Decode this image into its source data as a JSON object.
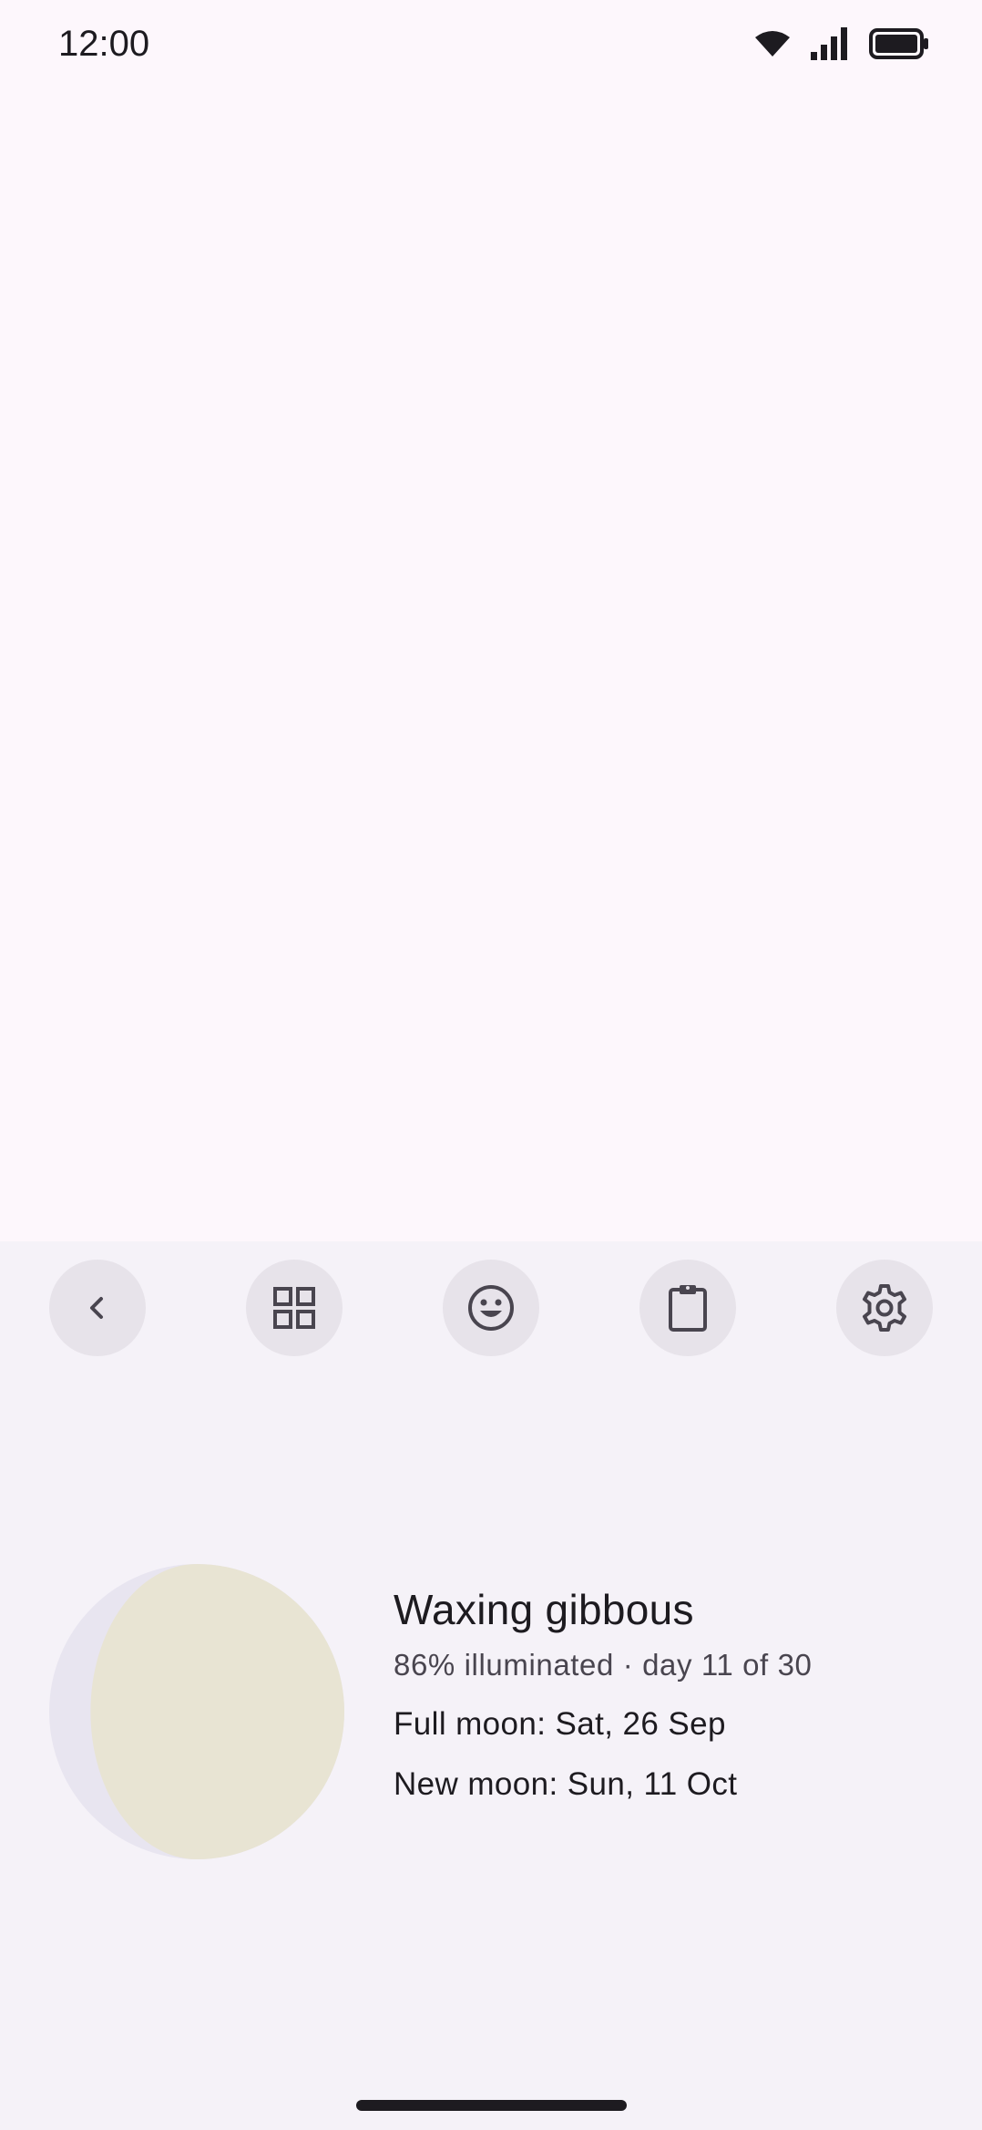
{
  "status_bar": {
    "time": "12:00",
    "icons": [
      "wifi-icon",
      "signal-icon",
      "battery-icon"
    ]
  },
  "toolbar": {
    "buttons": [
      {
        "icon": "chevron-left-icon"
      },
      {
        "icon": "grid-icon"
      },
      {
        "icon": "emoji-icon"
      },
      {
        "icon": "clipboard-icon"
      },
      {
        "icon": "gear-icon"
      }
    ]
  },
  "moon": {
    "phase": "Waxing gibbous",
    "illumination_line": "86% illuminated · day 11 of 30",
    "illuminated_fraction": 0.86,
    "full_moon": "Full moon: Sat, 26 Sep",
    "new_moon": "New moon: Sun, 11 Oct",
    "lit_color": "#e8e4d3",
    "dark_color": "#e8e5f0"
  },
  "colors": {
    "background": "#fdf7fc",
    "keyboard_background": "#f5f2f8",
    "button_background": "#e7e3ea",
    "icon_color": "#49454f",
    "text_primary": "#1d1b20",
    "text_secondary": "#49454f"
  }
}
